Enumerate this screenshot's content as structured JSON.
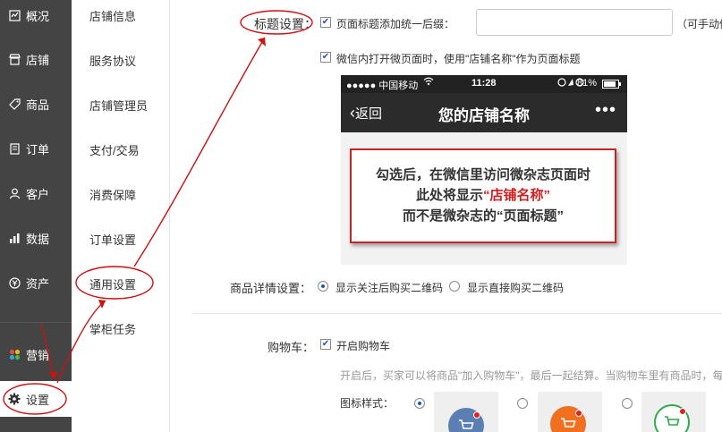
{
  "nav": {
    "items": [
      {
        "label": "概况",
        "icon": "overview-icon"
      },
      {
        "label": "店铺",
        "icon": "store-icon"
      },
      {
        "label": "商品",
        "icon": "tag-icon"
      },
      {
        "label": "订单",
        "icon": "order-icon"
      },
      {
        "label": "客户",
        "icon": "customer-icon"
      },
      {
        "label": "数据",
        "icon": "chart-icon"
      },
      {
        "label": "资产",
        "icon": "yen-icon"
      },
      {
        "label": "营销",
        "icon": "marketing-icon"
      },
      {
        "label": "设置",
        "icon": "gear-icon"
      }
    ]
  },
  "subnav": {
    "items": [
      "店铺信息",
      "服务协议",
      "店铺管理员",
      "支付/交易",
      "消费保障",
      "订单设置",
      "通用设置",
      "掌柜任务"
    ]
  },
  "title_setting": {
    "label": "标题设置：",
    "suffix_label": "页面标题添加统一后缀：",
    "suffix_value": "",
    "suffix_note": "（可手动修",
    "wechat_label": "微信内打开微页面时，使用\"店铺名称\"作为页面标题"
  },
  "phone": {
    "carrier": "●●●●● 中国移动",
    "time": "11:28",
    "battery": "81%",
    "back": "返回",
    "title": "您的店铺名称",
    "more": "•••",
    "callout_line1": "勾选后，在微信里访问微杂志页面时",
    "callout_line2_a": "此处将显示",
    "callout_line2_b": "“店铺名称”",
    "callout_line3": "而不是微杂志的“页面标题”"
  },
  "detail_setting": {
    "label": "商品详情设置：",
    "option1": "显示关注后购买二维码",
    "option2": "显示直接购买二维码"
  },
  "cart": {
    "label": "购物车：",
    "enable_label": "开启购物车",
    "hint": "开启后，买家可以将商品\"加入购物车\"，最后一起结算。当购物车里有商品时，每",
    "icon_style_label": "图标样式：",
    "styles": [
      {
        "color": "#5b7fb3"
      },
      {
        "color": "#f07020"
      },
      {
        "color": "#ffffff"
      }
    ]
  },
  "colors": {
    "nav_bg": "#444444",
    "annotation_red": "#cc1111",
    "accent_blue": "#1a55c8"
  }
}
